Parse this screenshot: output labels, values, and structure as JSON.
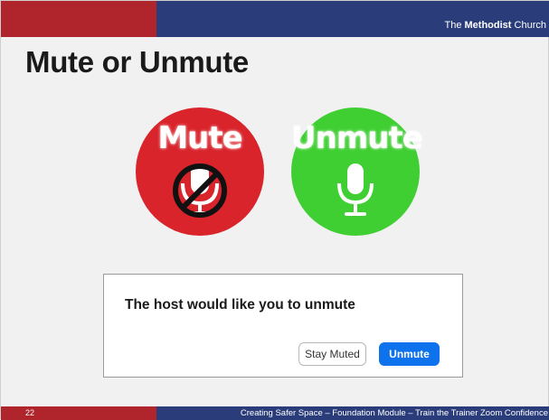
{
  "header": {
    "logo_prefix": "The ",
    "logo_bold": "Methodist",
    "logo_suffix": " Church"
  },
  "slide": {
    "title": "Mute or Unmute"
  },
  "graphics": {
    "mute_label": "Mute",
    "unmute_label": "Unmute",
    "colors": {
      "mute_red": "#d9242c",
      "unmute_green": "#3fcf32",
      "brand_navy": "#2a3d7a",
      "brand_red": "#b0252b",
      "zoom_blue": "#0e72ed"
    }
  },
  "dialog": {
    "message": "The host would like you to unmute",
    "stay_muted_label": "Stay Muted",
    "unmute_label": "Unmute"
  },
  "footer": {
    "page_number": "22",
    "text": "Creating Safer Space – Foundation Module – Train the Trainer Zoom Confidence"
  }
}
